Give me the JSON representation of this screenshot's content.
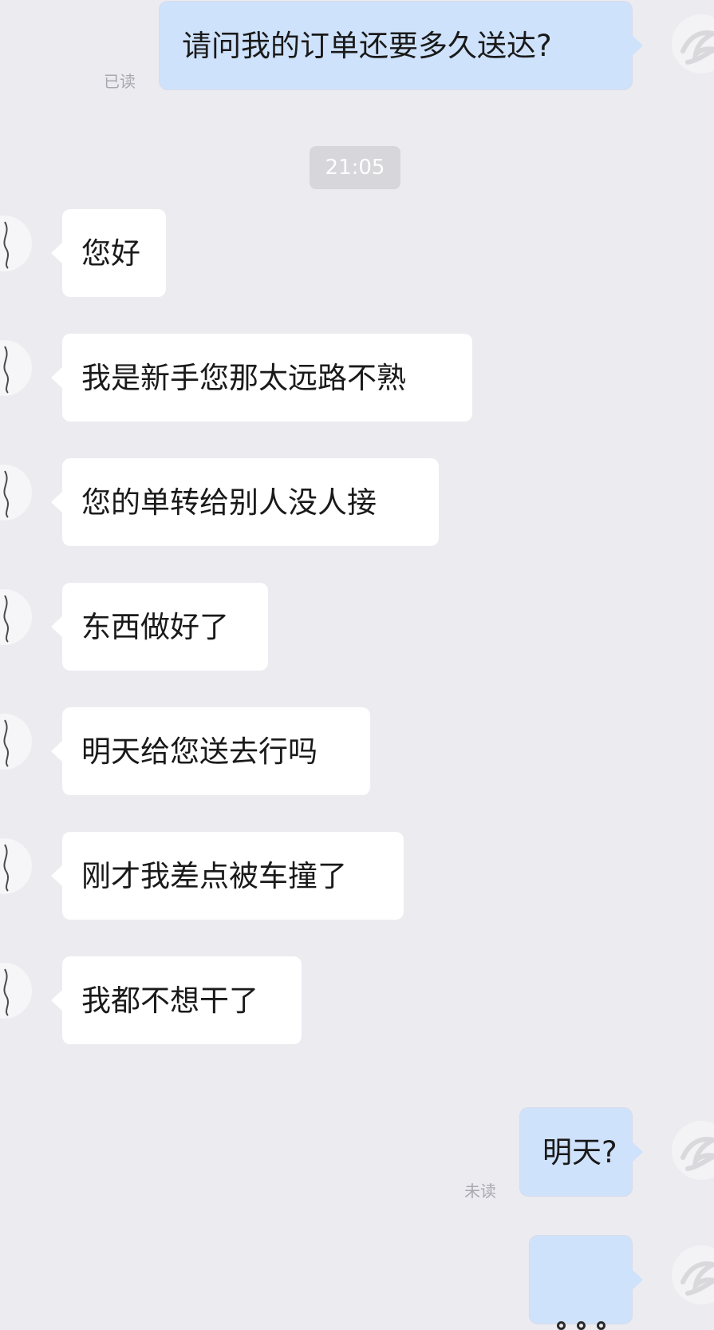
{
  "conversation": {
    "messages": [
      {
        "direction": "outgoing",
        "text": "请问我的订单还要多久送达?",
        "status": "已读"
      },
      {
        "direction": "incoming",
        "text": "您好"
      },
      {
        "direction": "incoming",
        "text": "我是新手您那太远路不熟"
      },
      {
        "direction": "incoming",
        "text": "您的单转给别人没人接"
      },
      {
        "direction": "incoming",
        "text": "东西做好了"
      },
      {
        "direction": "incoming",
        "text": "明天给您送去行吗"
      },
      {
        "direction": "incoming",
        "text": "刚才我差点被车撞了"
      },
      {
        "direction": "incoming",
        "text": "我都不想干了"
      },
      {
        "direction": "outgoing",
        "text": "明天?",
        "status": "未读"
      },
      {
        "direction": "outgoing",
        "text": ""
      }
    ],
    "timestamp": "21:05"
  },
  "icons": {
    "contact_avatar": "contact-avatar-icon",
    "user_avatar": "user-avatar-icon",
    "partial_message": "ellipsis-icon"
  },
  "colors": {
    "background": "#ecebf0",
    "incoming_bubble": "#ffffff",
    "outgoing_bubble": "#cfe2fb",
    "status_text": "#a8a8ae",
    "timestamp_pill": "#d7d6db"
  }
}
